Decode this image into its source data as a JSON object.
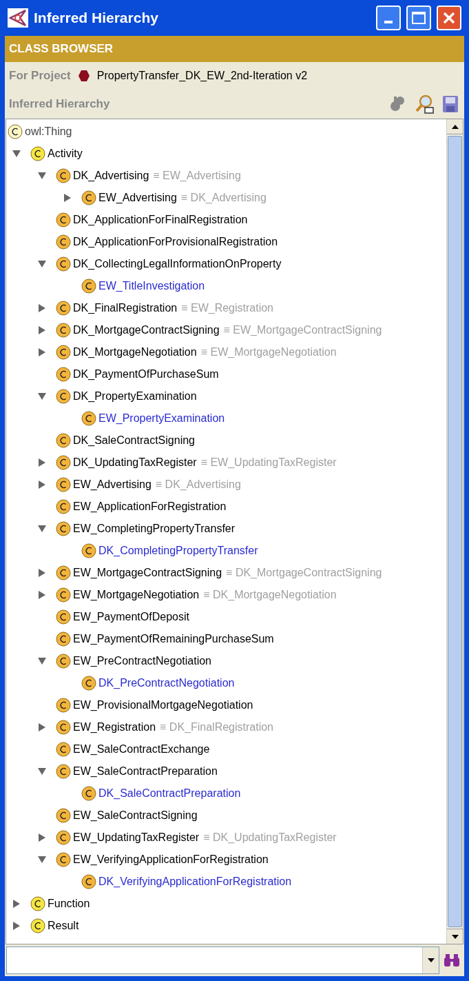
{
  "window": {
    "title": "Inferred Hierarchy"
  },
  "banner": "CLASS BROWSER",
  "project": {
    "label": "For Project",
    "name": "PropertyTransfer_DK_EW_2nd-Iteration v2"
  },
  "panel": {
    "title": "Inferred Hierarchy"
  },
  "tree": [
    {
      "label": "owl:Thing",
      "color": "#fff6c8",
      "inferred": false,
      "children": [
        {
          "label": "Activity",
          "color": "#f5e642",
          "inferred": false,
          "expanded": true,
          "children": [
            {
              "label": "DK_Advertising",
              "equivalent": "≡ EW_Advertising",
              "color": "#f3b43c",
              "inferred": false,
              "expanded": true,
              "children": [
                {
                  "label": "EW_Advertising",
                  "equivalent": "≡ DK_Advertising",
                  "color": "#f3b43c",
                  "inferred": false,
                  "expanded": false
                }
              ]
            },
            {
              "label": "DK_ApplicationForFinalRegistration",
              "color": "#f3b43c",
              "inferred": false
            },
            {
              "label": "DK_ApplicationForProvisionalRegistration",
              "color": "#f3b43c",
              "inferred": false
            },
            {
              "label": "DK_CollectingLegalInformationOnProperty",
              "color": "#f3b43c",
              "inferred": false,
              "expanded": true,
              "children": [
                {
                  "label": "EW_TitleInvestigation",
                  "color": "#f3b43c",
                  "inferred": true
                }
              ]
            },
            {
              "label": "DK_FinalRegistration",
              "equivalent": "≡ EW_Registration",
              "color": "#f3b43c",
              "inferred": false,
              "expanded": false
            },
            {
              "label": "DK_MortgageContractSigning",
              "equivalent": "≡ EW_MortgageContractSigning",
              "color": "#f3b43c",
              "inferred": false,
              "expanded": false
            },
            {
              "label": "DK_MortgageNegotiation",
              "equivalent": "≡ EW_MortgageNegotiation",
              "color": "#f3b43c",
              "inferred": false,
              "expanded": false
            },
            {
              "label": "DK_PaymentOfPurchaseSum",
              "color": "#f3b43c",
              "inferred": false
            },
            {
              "label": "DK_PropertyExamination",
              "color": "#f3b43c",
              "inferred": false,
              "expanded": true,
              "children": [
                {
                  "label": "EW_PropertyExamination",
                  "color": "#f3b43c",
                  "inferred": true
                }
              ]
            },
            {
              "label": "DK_SaleContractSigning",
              "color": "#f3b43c",
              "inferred": false
            },
            {
              "label": "DK_UpdatingTaxRegister",
              "equivalent": "≡ EW_UpdatingTaxRegister",
              "color": "#f3b43c",
              "inferred": false,
              "expanded": false
            },
            {
              "label": "EW_Advertising",
              "equivalent": "≡ DK_Advertising",
              "color": "#f3b43c",
              "inferred": false,
              "expanded": false
            },
            {
              "label": "EW_ApplicationForRegistration",
              "color": "#f3b43c",
              "inferred": false
            },
            {
              "label": "EW_CompletingPropertyTransfer",
              "color": "#f3b43c",
              "inferred": false,
              "expanded": true,
              "children": [
                {
                  "label": "DK_CompletingPropertyTransfer",
                  "color": "#f3b43c",
                  "inferred": true
                }
              ]
            },
            {
              "label": "EW_MortgageContractSigning",
              "equivalent": "≡ DK_MortgageContractSigning",
              "color": "#f3b43c",
              "inferred": false,
              "expanded": false
            },
            {
              "label": "EW_MortgageNegotiation",
              "equivalent": "≡ DK_MortgageNegotiation",
              "color": "#f3b43c",
              "inferred": false,
              "expanded": false
            },
            {
              "label": "EW_PaymentOfDeposit",
              "color": "#f3b43c",
              "inferred": false
            },
            {
              "label": "EW_PaymentOfRemainingPurchaseSum",
              "color": "#f3b43c",
              "inferred": false
            },
            {
              "label": "EW_PreContractNegotiation",
              "color": "#f3b43c",
              "inferred": false,
              "expanded": true,
              "children": [
                {
                  "label": "DK_PreContractNegotiation",
                  "color": "#f3b43c",
                  "inferred": true
                }
              ]
            },
            {
              "label": "EW_ProvisionalMortgageNegotiation",
              "color": "#f3b43c",
              "inferred": false
            },
            {
              "label": "EW_Registration",
              "equivalent": "≡ DK_FinalRegistration",
              "color": "#f3b43c",
              "inferred": false,
              "expanded": false
            },
            {
              "label": "EW_SaleContractExchange",
              "color": "#f3b43c",
              "inferred": false
            },
            {
              "label": "EW_SaleContractPreparation",
              "color": "#f3b43c",
              "inferred": false,
              "expanded": true,
              "children": [
                {
                  "label": "DK_SaleContractPreparation",
                  "color": "#f3b43c",
                  "inferred": true
                }
              ]
            },
            {
              "label": "EW_SaleContractSigning",
              "color": "#f3b43c",
              "inferred": false
            },
            {
              "label": "EW_UpdatingTaxRegister",
              "equivalent": "≡ DK_UpdatingTaxRegister",
              "color": "#f3b43c",
              "inferred": false,
              "expanded": false
            },
            {
              "label": "EW_VerifyingApplicationForRegistration",
              "color": "#f3b43c",
              "inferred": false,
              "expanded": true,
              "children": [
                {
                  "label": "DK_VerifyingApplicationForRegistration",
                  "color": "#f3b43c",
                  "inferred": true
                }
              ]
            }
          ]
        },
        {
          "label": "Function",
          "color": "#f5e642",
          "inferred": false,
          "expanded": false
        },
        {
          "label": "Result",
          "color": "#f5e642",
          "inferred": false,
          "expanded": false
        }
      ]
    }
  ]
}
